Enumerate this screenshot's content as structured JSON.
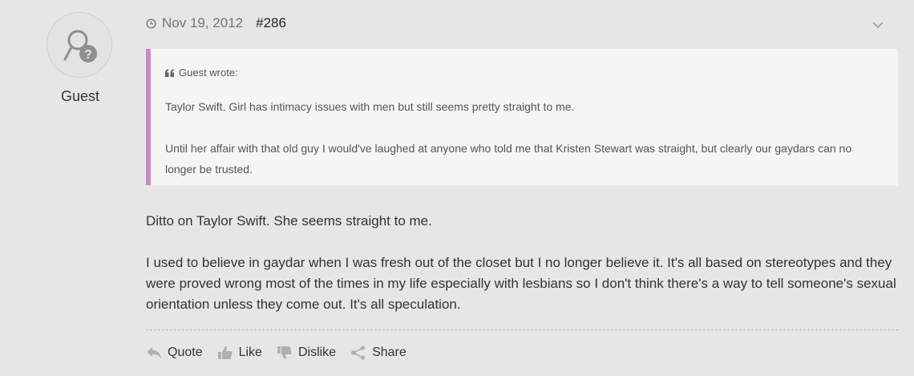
{
  "author": {
    "name": "Guest"
  },
  "post": {
    "date": "Nov 19, 2012",
    "number": "#286"
  },
  "quote": {
    "attribution": "Guest wrote:",
    "paragraphs": [
      "Taylor Swift. Girl has intimacy issues with men but still seems pretty straight to me.",
      "Until her affair with that old guy I would've laughed at anyone who told me that Kristen Stewart was straight, but clearly our gaydars can no longer be trusted."
    ]
  },
  "body": {
    "paragraphs": [
      "Ditto on Taylor Swift. She seems straight to me.",
      "I used to believe in gaydar when I was fresh out of the closet but I no longer believe it. It's all based on stereotypes and they were proved wrong most of the times in my life especially with lesbians so I don't think there's a way to tell someone's sexual orientation unless they come out. It's all speculation."
    ]
  },
  "actions": {
    "quote": "Quote",
    "like": "Like",
    "dislike": "Dislike",
    "share": "Share"
  },
  "colors": {
    "background": "#e6e6e6",
    "quote_border": "#c48cc4",
    "quote_background": "#f5f5f5"
  },
  "icons": [
    "guest-avatar-icon",
    "clock-icon",
    "chevron-down-icon",
    "quote-mark-icon",
    "reply-arrow-icon",
    "thumbs-up-icon",
    "thumbs-down-icon",
    "share-icon"
  ]
}
